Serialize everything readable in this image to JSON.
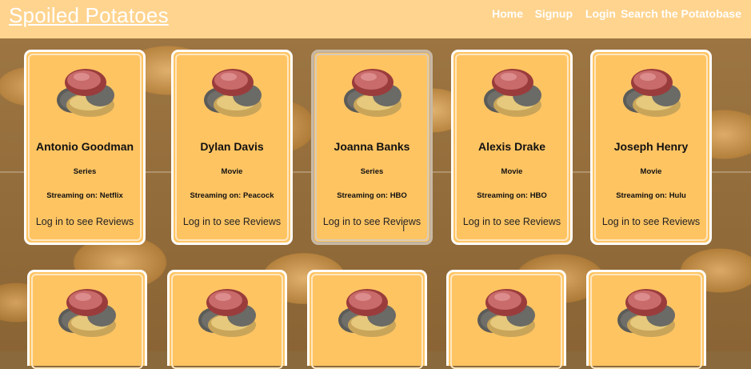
{
  "navbar": {
    "brand": "Spoiled Potatoes",
    "links": [
      "Home",
      "Signup",
      "Login",
      "Search the Potatobase"
    ]
  },
  "cards": [
    {
      "name": "Antonio Goodman",
      "type": "Series",
      "streaming": "Streaming on: Netflix",
      "reviews": "Log in to see Reviews"
    },
    {
      "name": "Dylan Davis",
      "type": "Movie",
      "streaming": "Streaming on: Peacock",
      "reviews": "Log in to see Reviews"
    },
    {
      "name": "Joanna Banks",
      "type": "Series",
      "streaming": "Streaming on: HBO",
      "reviews": "Log in to see Reviews"
    },
    {
      "name": "Alexis Drake",
      "type": "Movie",
      "streaming": "Streaming on: HBO",
      "reviews": "Log in to see Reviews"
    },
    {
      "name": "Joseph Henry",
      "type": "Movie",
      "streaming": "Streaming on: Hulu",
      "reviews": "Log in to see Reviews"
    }
  ]
}
